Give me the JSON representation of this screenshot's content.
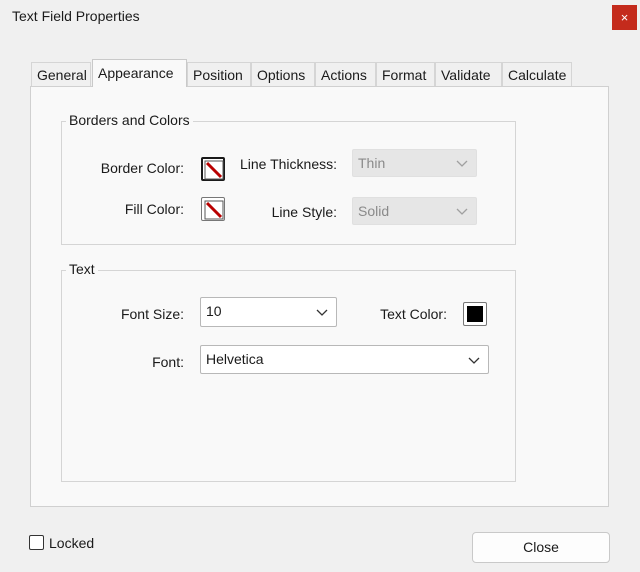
{
  "window": {
    "title": "Text Field Properties",
    "close_glyph": "×"
  },
  "tabs": [
    "General",
    "Appearance",
    "Position",
    "Options",
    "Actions",
    "Format",
    "Validate",
    "Calculate"
  ],
  "active_tab": "Appearance",
  "borders_colors": {
    "legend": "Borders and Colors",
    "border_color_label": "Border Color:",
    "fill_color_label": "Fill Color:",
    "line_thickness_label": "Line Thickness:",
    "line_thickness_value": "Thin",
    "line_style_label": "Line Style:",
    "line_style_value": "Solid",
    "swatch_icon": "no-color-icon",
    "no_color_stroke": "#b80000"
  },
  "text": {
    "legend": "Text",
    "font_size_label": "Font Size:",
    "font_size_value": "10",
    "text_color_label": "Text Color:",
    "text_color_value": "#000000",
    "font_label": "Font:",
    "font_value": "Helvetica"
  },
  "footer": {
    "locked_label": "Locked",
    "locked_checked": false,
    "close_label": "Close"
  }
}
